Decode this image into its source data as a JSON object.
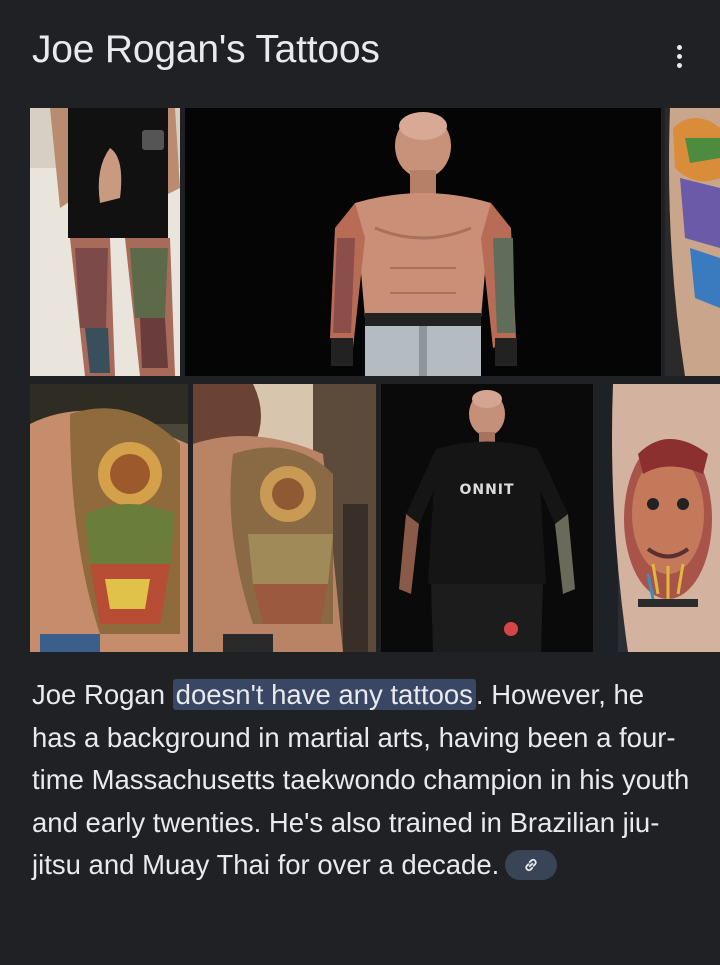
{
  "header": {
    "title": "Joe Rogan's Tattoos",
    "more_icon": "more-vert-icon"
  },
  "images": [
    {
      "name": "legs-tattoo-photo"
    },
    {
      "name": "shirtless-tattoo-photo"
    },
    {
      "name": "calf-tattoo-photo-partial"
    },
    {
      "name": "shoulder-tattoo-photo"
    },
    {
      "name": "arm-back-tattoo-photo"
    },
    {
      "name": "onnit-shirt-photo"
    },
    {
      "name": "forearm-portrait-tattoo-photo"
    }
  ],
  "shirt_logo": "ONNIT",
  "description": {
    "prefix": "Joe Rogan ",
    "highlight": "doesn't have any tattoos",
    "suffix": ". However, he has a background in martial arts, having been a four-time Massachusetts taekwondo champion in his youth and early twenties. He's also trained in Brazilian jiu-jitsu and Muay Thai for over a decade.",
    "link_icon": "link-icon"
  },
  "colors": {
    "background": "#202124",
    "text": "#e8eaed",
    "highlight": "#394764",
    "chip": "#394457"
  }
}
